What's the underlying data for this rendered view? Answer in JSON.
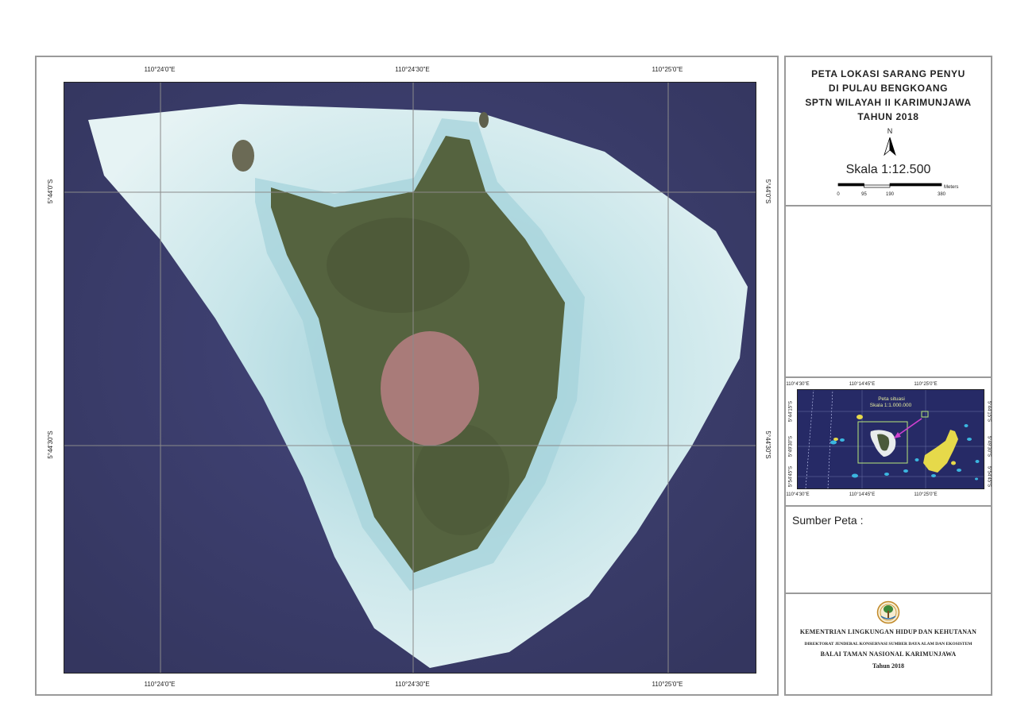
{
  "map": {
    "lon_ticks": [
      "110°24'0\"E",
      "110°24'30\"E",
      "110°25'0\"E"
    ],
    "lat_ticks": [
      "5°44'0\"S",
      "5°44'30\"S"
    ]
  },
  "legend": {
    "title_lines": [
      "PETA LOKASI SARANG PENYU",
      "DI PULAU BENGKOANG",
      "SPTN WILAYAH II KARIMUNJAWA",
      "TAHUN 2018"
    ],
    "north_label": "N",
    "north_icon": "north-arrow-icon",
    "scale_text": "Skala 1:12.500",
    "scale_bar": {
      "ticks": [
        "0",
        "95",
        "190",
        "380"
      ],
      "unit": "Meters"
    }
  },
  "inset": {
    "lon_ticks": [
      "110°4'30\"E",
      "110°14'45\"E",
      "110°25'0\"E"
    ],
    "lat_ticks": [
      "5°44'15\"S",
      "5°49'30\"S",
      "5°54'45\"S"
    ],
    "label": "Peta situasi",
    "scale": "Skala 1:1.000.000"
  },
  "source": {
    "label": "Sumber Peta :"
  },
  "footer": {
    "logo_icon": "ministry-logo-icon",
    "ministry": "KEMENTRIAN LINGKUNGAN HIDUP DAN KEHUTANAN",
    "directorate": "DIREKTORAT JENDERAL KONSERVASI SUMBER DAYA ALAM DAN EKOSISTEM",
    "office": "BALAI TAMAN NASIONAL KARIMUNJAWA",
    "year": "Tahun 2018"
  },
  "colors": {
    "sea": "#3b3d6e",
    "reef": "#d8ecef",
    "vegetation": "#55633f",
    "bare_ground": "#a97b79",
    "inset_sea": "#262a66",
    "inset_islands": "#e6d94a"
  }
}
